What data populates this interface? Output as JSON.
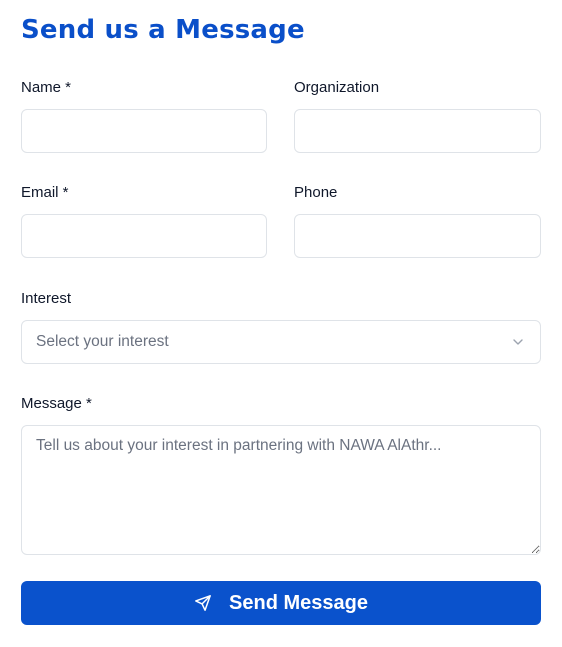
{
  "form": {
    "title": "Send us a Message",
    "name": {
      "label": "Name *",
      "value": ""
    },
    "organization": {
      "label": "Organization",
      "value": ""
    },
    "email": {
      "label": "Email *",
      "value": ""
    },
    "phone": {
      "label": "Phone",
      "value": ""
    },
    "interest": {
      "label": "Interest",
      "selected": "Select your interest",
      "icon": "chevron-down-icon"
    },
    "message": {
      "label": "Message *",
      "placeholder": "Tell us about your interest in partnering with NAWA AlAthr...",
      "value": ""
    },
    "submit": {
      "label": "Send Message",
      "icon": "send-icon"
    }
  },
  "colors": {
    "title": "#0a4fc9",
    "button_background": "#0a52cc",
    "button_text": "#ffffff",
    "label": "#0f172a",
    "border": "#dfe3e8",
    "placeholder": "#6b7280"
  }
}
